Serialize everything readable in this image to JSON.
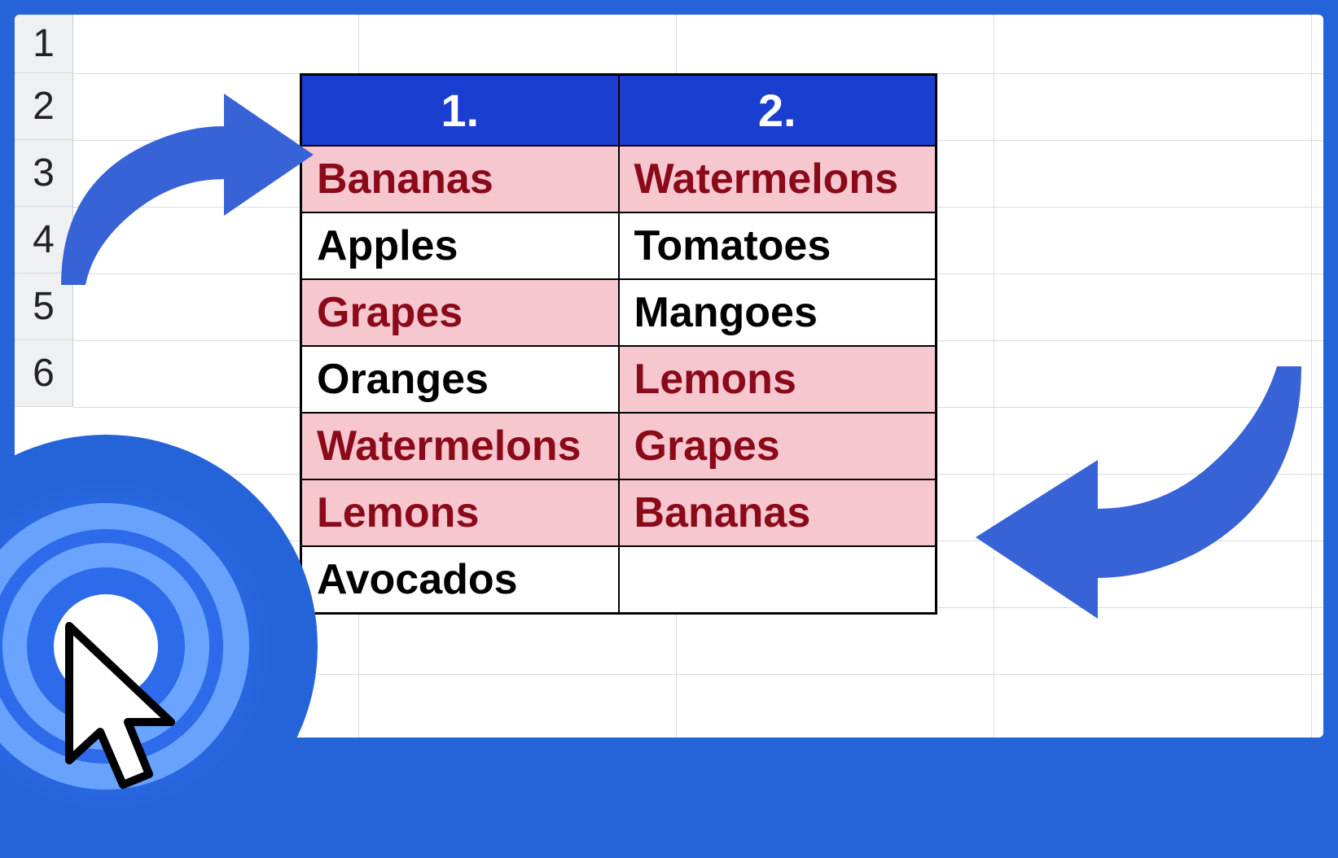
{
  "row_headers": [
    "1",
    "2",
    "3",
    "4",
    "5",
    "6"
  ],
  "table": {
    "headers": [
      "1.",
      "2."
    ],
    "rows": [
      [
        {
          "value": "Bananas",
          "highlight": true
        },
        {
          "value": "Watermelons",
          "highlight": true
        }
      ],
      [
        {
          "value": "Apples",
          "highlight": false
        },
        {
          "value": "Tomatoes",
          "highlight": false
        }
      ],
      [
        {
          "value": "Grapes",
          "highlight": true
        },
        {
          "value": "Mangoes",
          "highlight": false
        }
      ],
      [
        {
          "value": "Oranges",
          "highlight": false
        },
        {
          "value": "Lemons",
          "highlight": true
        }
      ],
      [
        {
          "value": "Watermelons",
          "highlight": true
        },
        {
          "value": "Grapes",
          "highlight": true
        }
      ],
      [
        {
          "value": "Lemons",
          "highlight": true
        },
        {
          "value": "Bananas",
          "highlight": true
        }
      ],
      [
        {
          "value": "Avocados",
          "highlight": false
        },
        {
          "value": "",
          "highlight": false
        }
      ]
    ]
  },
  "colors": {
    "frame": "#2563d9",
    "header_fill": "#1a3ecf",
    "highlight_fill": "#f7c7cf",
    "highlight_text": "#8b0a1a"
  }
}
